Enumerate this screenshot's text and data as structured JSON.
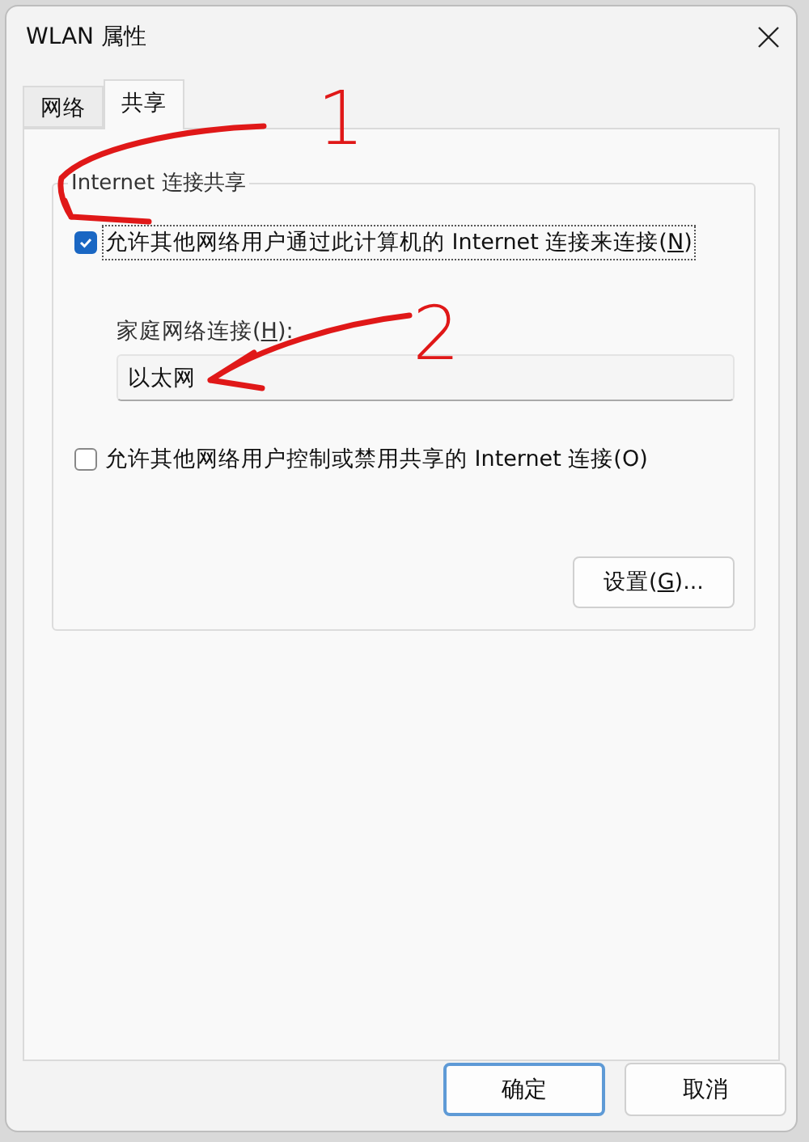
{
  "window": {
    "title": "WLAN 属性"
  },
  "tabs": [
    {
      "label": "网络",
      "selected": false
    },
    {
      "label": "共享",
      "selected": true
    }
  ],
  "group": {
    "title": "Internet 连接共享",
    "share_checkbox": {
      "label_before": "允许其他网络用户通过此计算机的 Internet 连接来连接(",
      "access_key": "N",
      "label_after": ")",
      "checked": true,
      "focused": true
    },
    "home_network": {
      "label_before": "家庭网络连接(",
      "access_key": "H",
      "label_after": "):",
      "value": "以太网"
    },
    "control_checkbox": {
      "label": "允许其他网络用户控制或禁用共享的 Internet 连接(O)",
      "checked": false
    },
    "settings_button": {
      "label_before": "设置(",
      "access_key": "G",
      "label_after": ")..."
    }
  },
  "buttons": [
    {
      "label": "确定",
      "default": true
    },
    {
      "label": "取消",
      "default": false
    }
  ],
  "annotations": [
    {
      "number": "1"
    },
    {
      "number": "2"
    }
  ]
}
